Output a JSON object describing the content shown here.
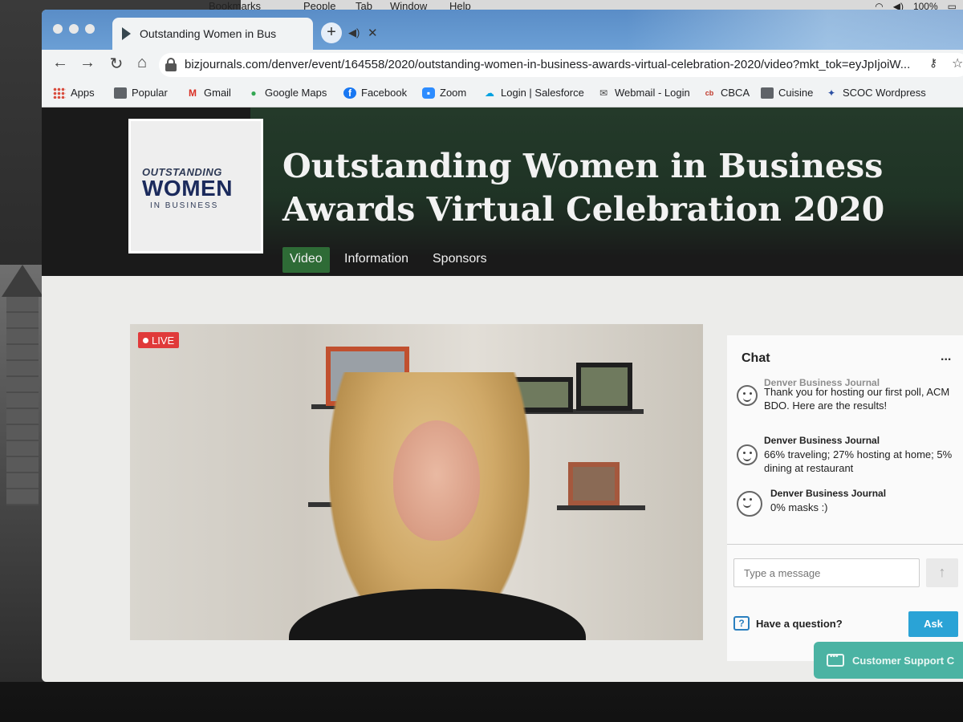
{
  "menubar": {
    "items": [
      "Bookmarks",
      "People",
      "Tab",
      "Window",
      "Help"
    ],
    "battery": "100%"
  },
  "browser": {
    "tab_title": "Outstanding Women in Bus",
    "url": "bizjournals.com/denver/event/164558/2020/outstanding-women-in-business-awards-virtual-celebration-2020/video?mkt_tok=eyJpIjoiW...",
    "bookmarks": [
      {
        "label": "Apps",
        "icon": "apps-grid-icon"
      },
      {
        "label": "Popular",
        "icon": "folder-icon"
      },
      {
        "label": "Gmail",
        "icon": "gmail-icon"
      },
      {
        "label": "Google Maps",
        "icon": "maps-pin-icon"
      },
      {
        "label": "Facebook",
        "icon": "facebook-icon"
      },
      {
        "label": "Zoom",
        "icon": "zoom-icon"
      },
      {
        "label": "Login | Salesforce",
        "icon": "salesforce-cloud-icon"
      },
      {
        "label": "Webmail - Login",
        "icon": "envelope-icon"
      },
      {
        "label": "CBCA",
        "icon": "cbca-icon"
      },
      {
        "label": "Cuisine",
        "icon": "folder-icon"
      },
      {
        "label": "SCOC Wordpress",
        "icon": "scoc-icon"
      }
    ]
  },
  "event": {
    "logo": {
      "line1": "OUTSTANDING",
      "line2": "WOMEN",
      "line3": "IN BUSINESS"
    },
    "title": "Outstanding Women in Business Awards Virtual Celebration 2020",
    "nav": [
      "Video",
      "Information",
      "Sponsors"
    ],
    "active_nav": "Video"
  },
  "video": {
    "live_label": "LIVE"
  },
  "chat": {
    "title": "Chat",
    "more": "...",
    "messages": [
      {
        "author": "Denver Business Journal",
        "text": "Thank you for hosting our first poll, ACM BDO. Here are the results!"
      },
      {
        "author": "Denver Business Journal",
        "text": "66% traveling; 27% hosting at home; 5% dining at restaurant"
      },
      {
        "author": "Denver Business Journal",
        "text": "0% masks :)"
      }
    ],
    "input_placeholder": "Type a message",
    "question_label": "Have a question?",
    "ask_label": "Ask"
  },
  "support": {
    "label": "Customer Support C"
  },
  "colors": {
    "tab_strip": "#6b9fd5",
    "hero_green": "#243a2a",
    "active_nav": "#2e6b36",
    "live_red": "#e03a3a",
    "ask_blue": "#2aa3d6",
    "support_teal": "#4bb3a3"
  }
}
